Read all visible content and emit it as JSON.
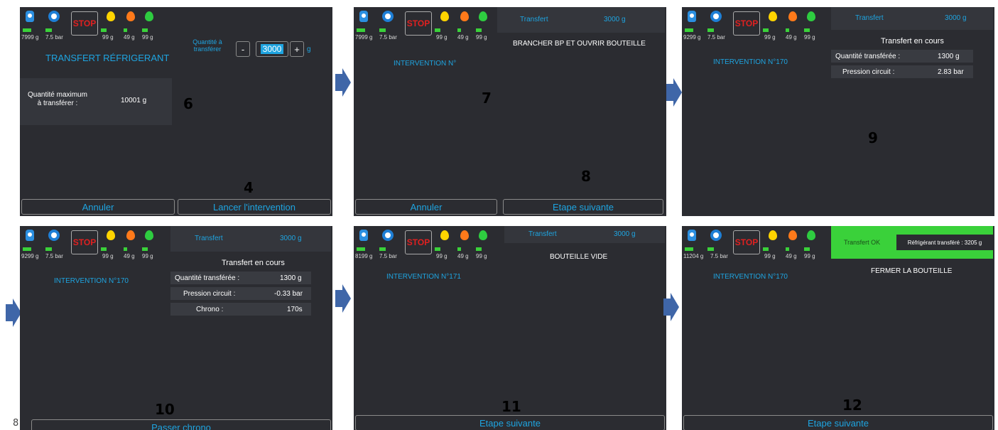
{
  "status": {
    "weight_a": "7999 g",
    "weight_b": "9299 g",
    "weight_c": "8199 g",
    "weight_d": "11204 g",
    "pressure": "7.5 bar",
    "stop": "STOP",
    "drop_yellow": "99 g",
    "drop_orange": "49 g",
    "drop_green": "99 g"
  },
  "screen6": {
    "title": "TRANSFERT RÉFRIGERANT",
    "qty_label": "Quantité à transférer",
    "minus": "-",
    "plus": "+",
    "qty_value": "3000",
    "unit": "g",
    "max_label": "Quantité maximum à transférer :",
    "max_value": "10001 g",
    "cancel": "Annuler",
    "launch": "Lancer l'intervention"
  },
  "screen7": {
    "transfer_label": "Transfert",
    "transfer_value": "3000 g",
    "intervention": "INTERVENTION N°",
    "message": "BRANCHER BP ET OUVRIR BOUTEILLE",
    "cancel": "Annuler",
    "next": "Etape suivante"
  },
  "screen9": {
    "transfer_label": "Transfert",
    "transfer_value": "3000 g",
    "intervention": "INTERVENTION N°170",
    "status": "Transfert en cours",
    "qty_label": "Quantité transférée :",
    "qty_value": "1300 g",
    "pressure_label": "Pression circuit :",
    "pressure_value": "2.83 bar"
  },
  "screen10": {
    "transfer_label": "Transfert",
    "transfer_value": "3000 g",
    "intervention": "INTERVENTION N°170",
    "status": "Transfert en cours",
    "qty_label": "Quantité transférée :",
    "qty_value": "1300 g",
    "pressure_label": "Pression circuit :",
    "pressure_value": "-0.33 bar",
    "chrono_label": "Chrono :",
    "chrono_value": "170s",
    "skip": "Passer chrono"
  },
  "screen11": {
    "transfer_label": "Transfert",
    "transfer_value": "3000 g",
    "intervention": "INTERVENTION N°171",
    "message": "BOUTEILLE VIDE",
    "next": "Etape suivante"
  },
  "screen12": {
    "ok_label": "Transfert OK",
    "transferred": "Réfrigérant transféré : 3205 g",
    "intervention": "INTERVENTION N°170",
    "message": "FERMER LA BOUTEILLE",
    "next": "Etape suivante"
  },
  "step_numbers": {
    "s6": "6",
    "s4": "4",
    "s7": "7",
    "s8": "8",
    "s9": "9",
    "s10": "10",
    "s11": "11",
    "s12": "12"
  },
  "page_number": "8",
  "colors": {
    "panel_bg": "#2b2c31",
    "accent": "#1ea4e0",
    "stop": "#e02020",
    "ok_green": "#3ad13a",
    "arrow": "#3f66a8"
  }
}
